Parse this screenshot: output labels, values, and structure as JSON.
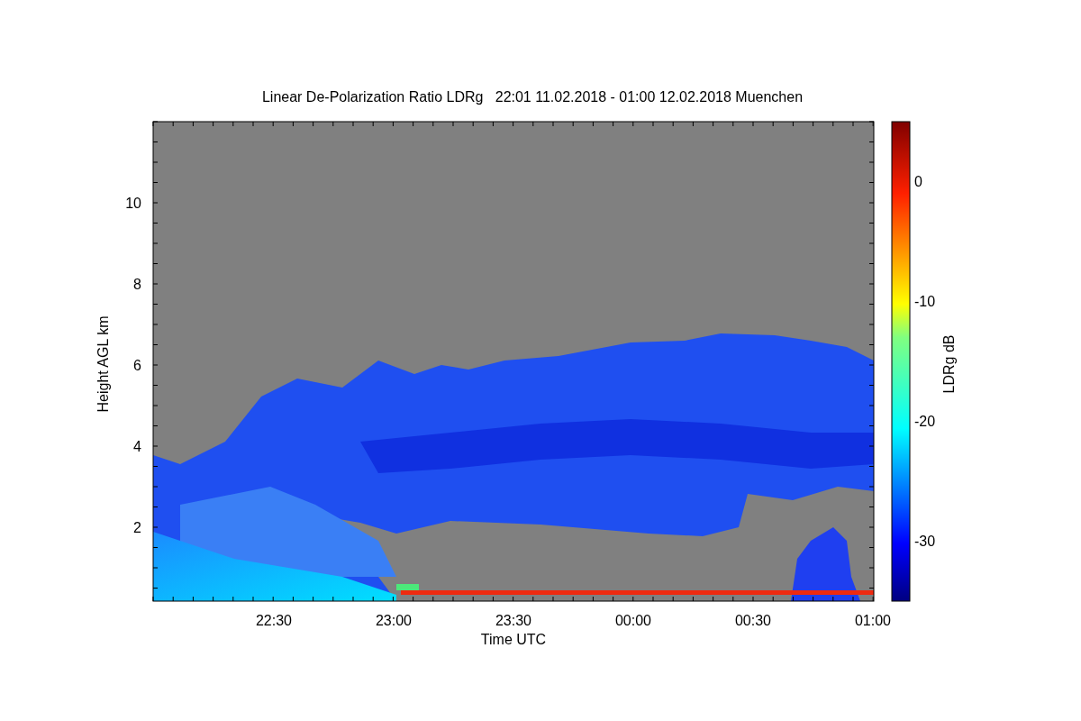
{
  "title": "Linear De-Polarization Ratio LDRg   22:01 11.02.2018 - 01:00 12.02.2018 Muenchen",
  "y_axis": {
    "label": "Height AGL km",
    "ticks": [
      "10",
      "8",
      "6",
      "4",
      "2"
    ]
  },
  "x_axis": {
    "label": "Time UTC",
    "ticks": [
      "22:30",
      "23:00",
      "23:30",
      "00:00",
      "00:30",
      "01:00"
    ]
  },
  "colorbar": {
    "label": "LDRg dB",
    "ticks": [
      "0",
      "-10",
      "-20",
      "-30"
    ]
  }
}
